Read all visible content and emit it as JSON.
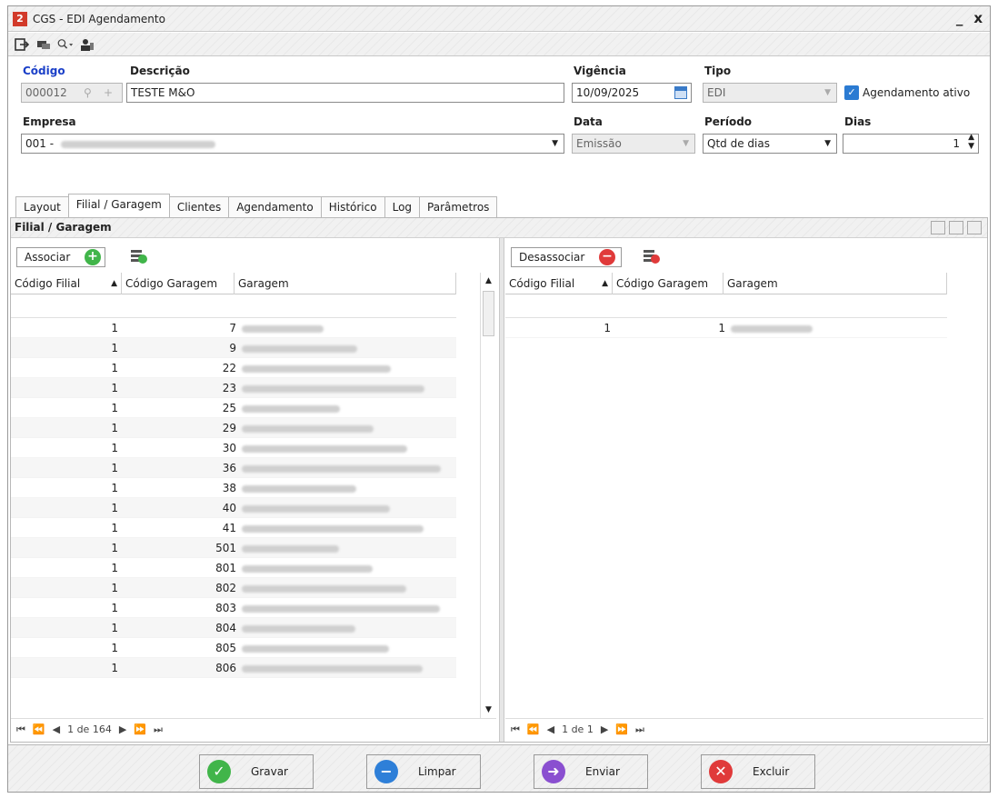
{
  "window": {
    "title": "CGS - EDI Agendamento",
    "minimize": "_",
    "close": "x"
  },
  "form": {
    "codigo_label": "Código",
    "codigo_value": "000012",
    "descricao_label": "Descrição",
    "descricao_value": "TESTE M&O",
    "vigencia_label": "Vigência",
    "vigencia_value": "10/09/2025",
    "tipo_label": "Tipo",
    "tipo_value": "EDI",
    "agendamento_ativo_label": "Agendamento ativo",
    "empresa_label": "Empresa",
    "empresa_value": "001 -",
    "data_label": "Data",
    "data_value": "Emissão",
    "periodo_label": "Período",
    "periodo_value": "Qtd de dias",
    "dias_label": "Dias",
    "dias_value": "1"
  },
  "tabs": [
    "Layout",
    "Filial / Garagem",
    "Clientes",
    "Agendamento",
    "Histórico",
    "Log",
    "Parâmetros"
  ],
  "panel_title": "Filial / Garagem",
  "left_grid": {
    "button_label": "Associar",
    "columns": [
      "Código Filial",
      "Código Garagem",
      "Garagem"
    ],
    "rows": [
      [
        "1",
        "7"
      ],
      [
        "1",
        "9"
      ],
      [
        "1",
        "22"
      ],
      [
        "1",
        "23"
      ],
      [
        "1",
        "25"
      ],
      [
        "1",
        "29"
      ],
      [
        "1",
        "30"
      ],
      [
        "1",
        "36"
      ],
      [
        "1",
        "38"
      ],
      [
        "1",
        "40"
      ],
      [
        "1",
        "41"
      ],
      [
        "1",
        "501"
      ],
      [
        "1",
        "801"
      ],
      [
        "1",
        "802"
      ],
      [
        "1",
        "803"
      ],
      [
        "1",
        "804"
      ],
      [
        "1",
        "805"
      ],
      [
        "1",
        "806"
      ]
    ],
    "pager": "1 de 164"
  },
  "right_grid": {
    "button_label": "Desassociar",
    "columns": [
      "Código Filial",
      "Código Garagem",
      "Garagem"
    ],
    "rows": [
      [
        "1",
        "1"
      ]
    ],
    "pager": "1 de 1"
  },
  "footer": {
    "gravar": "Gravar",
    "limpar": "Limpar",
    "enviar": "Enviar",
    "excluir": "Excluir"
  }
}
